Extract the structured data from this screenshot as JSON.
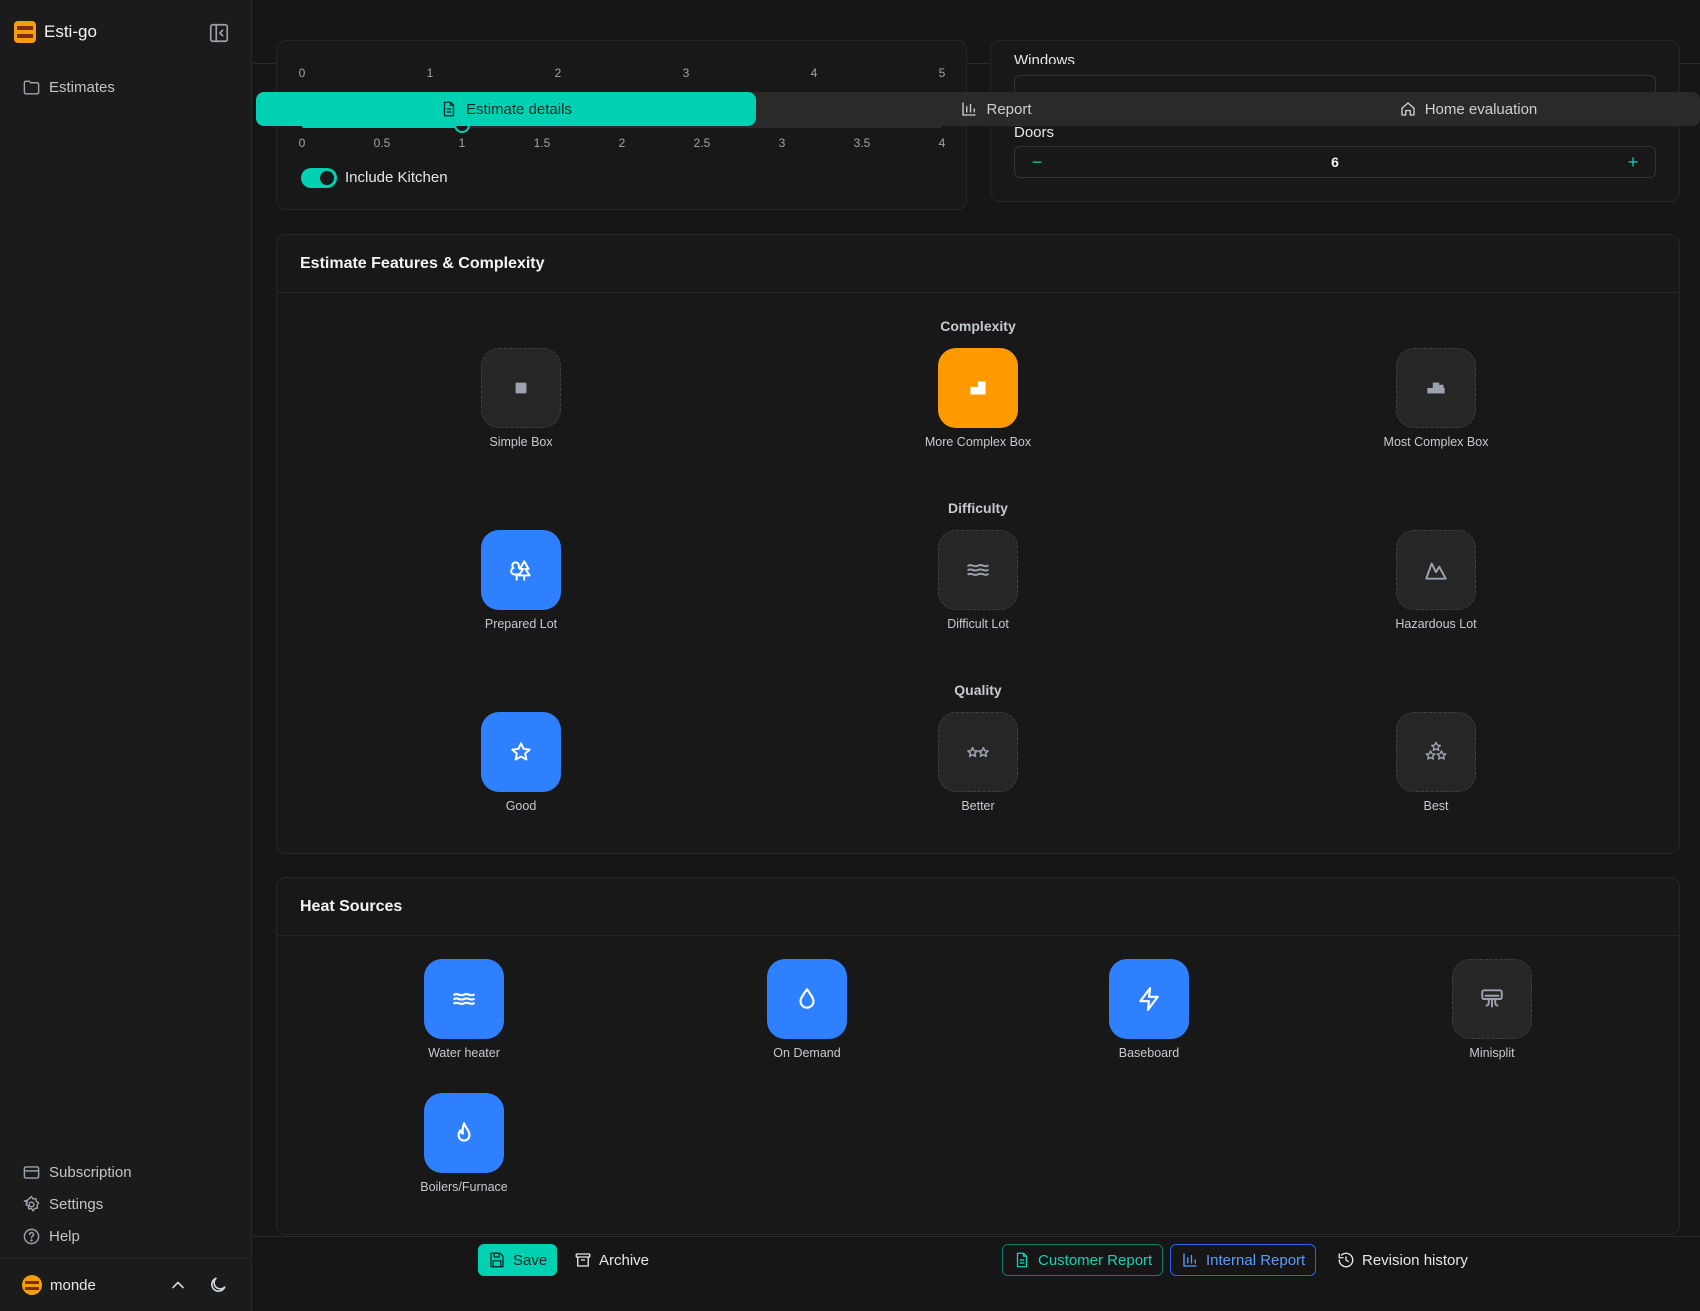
{
  "app": {
    "name": "Esti-go"
  },
  "sidebar": {
    "nav": [
      {
        "label": "Estimates",
        "icon": "folder-icon"
      }
    ],
    "footer_nav": [
      {
        "label": "Subscription",
        "icon": "credit-card-icon"
      },
      {
        "label": "Settings",
        "icon": "gear-icon"
      },
      {
        "label": "Help",
        "icon": "help-circle-icon"
      }
    ],
    "user": {
      "name": "monde"
    }
  },
  "tabs": [
    {
      "label": "Estimate details",
      "icon": "document-icon",
      "active": true
    },
    {
      "label": "Report",
      "icon": "bar-chart-icon",
      "active": false
    },
    {
      "label": "Home evaluation",
      "icon": "home-icon",
      "active": false
    }
  ],
  "top_section": {
    "slider1": {
      "ticks": [
        "0",
        "1",
        "2",
        "3",
        "4",
        "5"
      ]
    },
    "slider2": {
      "ticks": [
        "0",
        "0.5",
        "1",
        "1.5",
        "2",
        "2.5",
        "3",
        "3.5",
        "4"
      ],
      "value": 1,
      "max": 4
    },
    "include_kitchen": {
      "label": "Include Kitchen",
      "checked": true
    },
    "windows_label": "Windows",
    "doors": {
      "label": "Doors",
      "value": "6",
      "minus": "−",
      "plus": "+"
    }
  },
  "features": {
    "title": "Estimate Features & Complexity",
    "groups": [
      {
        "label": "Complexity",
        "options": [
          {
            "label": "Simple Box",
            "icon": "square-icon",
            "selected": false
          },
          {
            "label": "More Complex Box",
            "icon": "complex-box-icon",
            "selected": true,
            "color": "#ff9900"
          },
          {
            "label": "Most Complex Box",
            "icon": "most-complex-box-icon",
            "selected": false
          }
        ]
      },
      {
        "label": "Difficulty",
        "options": [
          {
            "label": "Prepared Lot",
            "icon": "trees-icon",
            "selected": true,
            "color": "#2f80ff"
          },
          {
            "label": "Difficult Lot",
            "icon": "waves-icon",
            "selected": false
          },
          {
            "label": "Hazardous Lot",
            "icon": "mountain-icon",
            "selected": false
          }
        ]
      },
      {
        "label": "Quality",
        "options": [
          {
            "label": "Good",
            "icon": "star-icon",
            "selected": true,
            "color": "#2f80ff"
          },
          {
            "label": "Better",
            "icon": "two-stars-icon",
            "selected": false
          },
          {
            "label": "Best",
            "icon": "three-stars-icon",
            "selected": false
          }
        ]
      }
    ]
  },
  "heat_sources": {
    "title": "Heat Sources",
    "options": [
      {
        "label": "Water heater",
        "icon": "waves-icon",
        "selected": true
      },
      {
        "label": "On Demand",
        "icon": "droplet-icon",
        "selected": true
      },
      {
        "label": "Baseboard",
        "icon": "lightning-icon",
        "selected": true
      },
      {
        "label": "Minisplit",
        "icon": "air-vent-icon",
        "selected": false
      },
      {
        "label": "Boilers/Furnace",
        "icon": "flame-icon",
        "selected": true
      }
    ]
  },
  "actions": {
    "save": "Save",
    "archive": "Archive",
    "customer_report": "Customer Report",
    "internal_report": "Internal Report",
    "revision_history": "Revision history"
  }
}
